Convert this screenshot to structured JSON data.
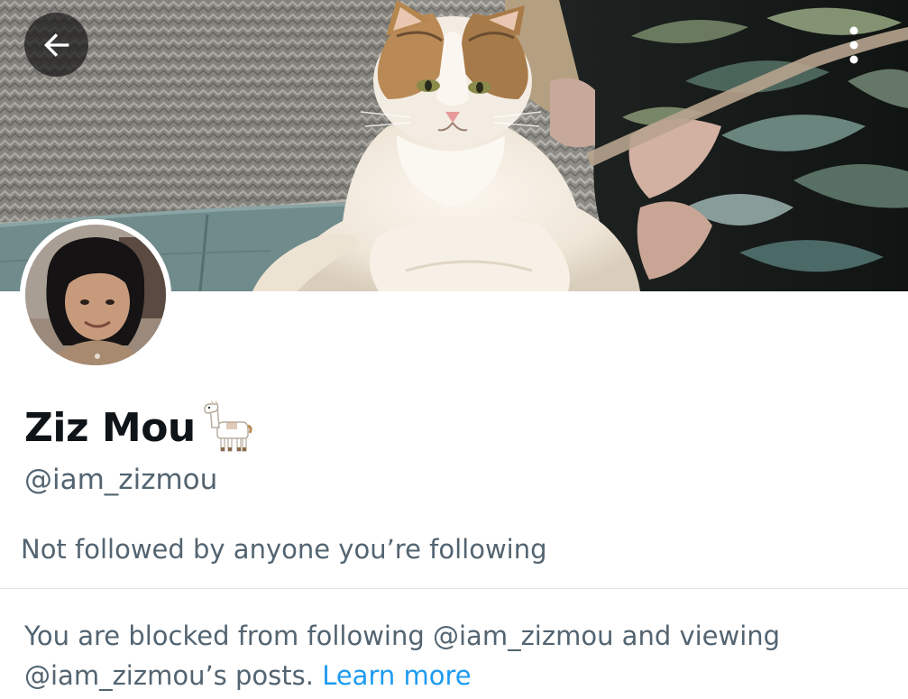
{
  "profile": {
    "display_name": "Ziz Mou",
    "name_emoji": "llama",
    "handle": "@iam_zizmou",
    "followers_you_know": "Not followed by anyone you’re following"
  },
  "header": {
    "back_icon": "arrow-left-icon",
    "more_icon": "vertical-ellipsis-icon"
  },
  "notice": {
    "text": "You are blocked from following @iam_zizmou and viewing @iam_zizmou’s posts.",
    "link_label": "Learn more"
  },
  "colors": {
    "primary_text": "#0f1419",
    "secondary_text": "#536471",
    "link": "#1d9bf0",
    "divider": "#dfe3e6"
  }
}
